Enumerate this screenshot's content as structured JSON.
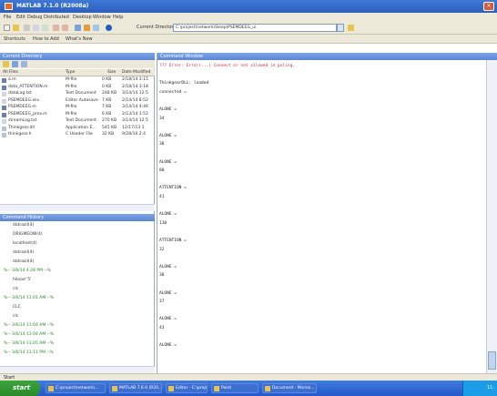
{
  "window": {
    "title": "MATLAB 7.1.0 (R2008a)"
  },
  "menu": [
    "File",
    "Edit",
    "Debug",
    "Distributed",
    "Desktop",
    "Window",
    "Help"
  ],
  "toolbar": {
    "current_dir_label": "Current Directory:",
    "current_dir": "C:\\project\\network\\Sleep\\PSEMDEEG_ui"
  },
  "shortcuts": [
    "Shortcuts",
    "How to Add",
    "What's New"
  ],
  "current_directory": {
    "header": "Current Directory",
    "columns": [
      "All Files",
      "Type",
      "Size",
      "Date Modified"
    ],
    "files": [
      {
        "name": "a.m",
        "type": "M-file",
        "size": "0 KB",
        "date": "2/18/14 3:15",
        "color": "#6a7fb5"
      },
      {
        "name": "data_ATTENTION.m",
        "type": "M-file",
        "size": "0 KB",
        "date": "2/18/14 3:18",
        "color": "#6a7fb5"
      },
      {
        "name": "dataLog.txt",
        "type": "Text Document",
        "size": "248 KB",
        "date": "3/14/14 12:5",
        "color": "#cfd6e6"
      },
      {
        "name": "PSEMDEEG.asv",
        "type": "Editor Autosave",
        "size": "7 KB",
        "date": "2/14/14 8:52",
        "color": "#cfd6e6"
      },
      {
        "name": "PSEMDEEG.m",
        "type": "M-file",
        "size": "7 KB",
        "date": "3/14/14 4:46",
        "color": "#6a7fb5"
      },
      {
        "name": "PSEMDEEG_prev.m",
        "type": "M-file",
        "size": "6 KB",
        "date": "2/13/14 1:52",
        "color": "#6a7fb5"
      },
      {
        "name": "streamLog.txt",
        "type": "Text Document",
        "size": "270 KB",
        "date": "3/14/14 12:5",
        "color": "#cfd6e6"
      },
      {
        "name": "Thinkgear.dll",
        "type": "Application E...",
        "size": "545 KB",
        "date": "12/17/13 1",
        "color": "#b9c2d6"
      },
      {
        "name": "thinkgear.h",
        "type": "C Header File",
        "size": "32 KB",
        "date": "9/28/10 2:4",
        "color": "#b9c2d6"
      }
    ]
  },
  "command_history": {
    "header": "Command History",
    "entries": [
      {
        "text": "datrazil(4)",
        "sep": false
      },
      {
        "text": "ORIGMEOW(4)",
        "sep": false
      },
      {
        "text": "localhost(4)",
        "sep": false
      },
      {
        "text": "datrazil(4)",
        "sep": false
      },
      {
        "text": "datrazil(4)",
        "sep": false
      },
      {
        "text": "%-- 3/6/14  4:28 PM --%",
        "sep": true
      },
      {
        "text": "hiload '5'",
        "sep": false
      },
      {
        "text": "clc",
        "sep": false
      },
      {
        "text": "%-- 3/6/14 11:01 AM --%",
        "sep": true
      },
      {
        "text": "CLC",
        "sep": false
      },
      {
        "text": "clc",
        "sep": false
      },
      {
        "text": "%-- 3/6/14 11:04 AM --%",
        "sep": true
      },
      {
        "text": "%-- 3/6/14 11:04 AM --%",
        "sep": true
      },
      {
        "text": "%-- 3/6/14 11:05 AM --%",
        "sep": true
      },
      {
        "text": "%-- 3/6/14 11:11 PM --%",
        "sep": true
      }
    ]
  },
  "command_window": {
    "header": "Command Window",
    "lines": [
      {
        "text": "??? Error: Error(...) Connect or not allowed in poling.",
        "kind": "err"
      },
      {
        "text": "",
        "kind": "out"
      },
      {
        "text": "ThinkgearDLL: loaded",
        "kind": "out"
      },
      {
        "text": "connected =",
        "kind": "out"
      },
      {
        "text": "",
        "kind": "out"
      },
      {
        "text": "ALONE =",
        "kind": "out"
      },
      {
        "text": "    34",
        "kind": "out"
      },
      {
        "text": "",
        "kind": "out"
      },
      {
        "text": "ALONE =",
        "kind": "out"
      },
      {
        "text": "    38",
        "kind": "out"
      },
      {
        "text": "",
        "kind": "out"
      },
      {
        "text": "ALONE =",
        "kind": "out"
      },
      {
        "text": "    80",
        "kind": "out"
      },
      {
        "text": "",
        "kind": "out"
      },
      {
        "text": "ATTENTION =",
        "kind": "out"
      },
      {
        "text": "    41",
        "kind": "out"
      },
      {
        "text": "",
        "kind": "out"
      },
      {
        "text": "ALONE =",
        "kind": "out"
      },
      {
        "text": "    110",
        "kind": "out"
      },
      {
        "text": "",
        "kind": "out"
      },
      {
        "text": "ATTENTION =",
        "kind": "out"
      },
      {
        "text": "    32",
        "kind": "out"
      },
      {
        "text": "",
        "kind": "out"
      },
      {
        "text": "ALONE =",
        "kind": "out"
      },
      {
        "text": "    38",
        "kind": "out"
      },
      {
        "text": "",
        "kind": "out"
      },
      {
        "text": "ALONE =",
        "kind": "out"
      },
      {
        "text": "    37",
        "kind": "out"
      },
      {
        "text": "",
        "kind": "out"
      },
      {
        "text": "ALONE =",
        "kind": "out"
      },
      {
        "text": "    43",
        "kind": "out"
      },
      {
        "text": "",
        "kind": "out"
      },
      {
        "text": "ALONE =",
        "kind": "out"
      }
    ]
  },
  "statusbar": {
    "start_label": "Start"
  },
  "taskbar": {
    "start": "start",
    "items": [
      "C:\\project\\network\\...",
      "MATLAB 7.6.0 (R20...",
      "Editor - C:\\project\\ne...",
      "Paint",
      "Document - Micros..."
    ],
    "clock": "11:"
  }
}
